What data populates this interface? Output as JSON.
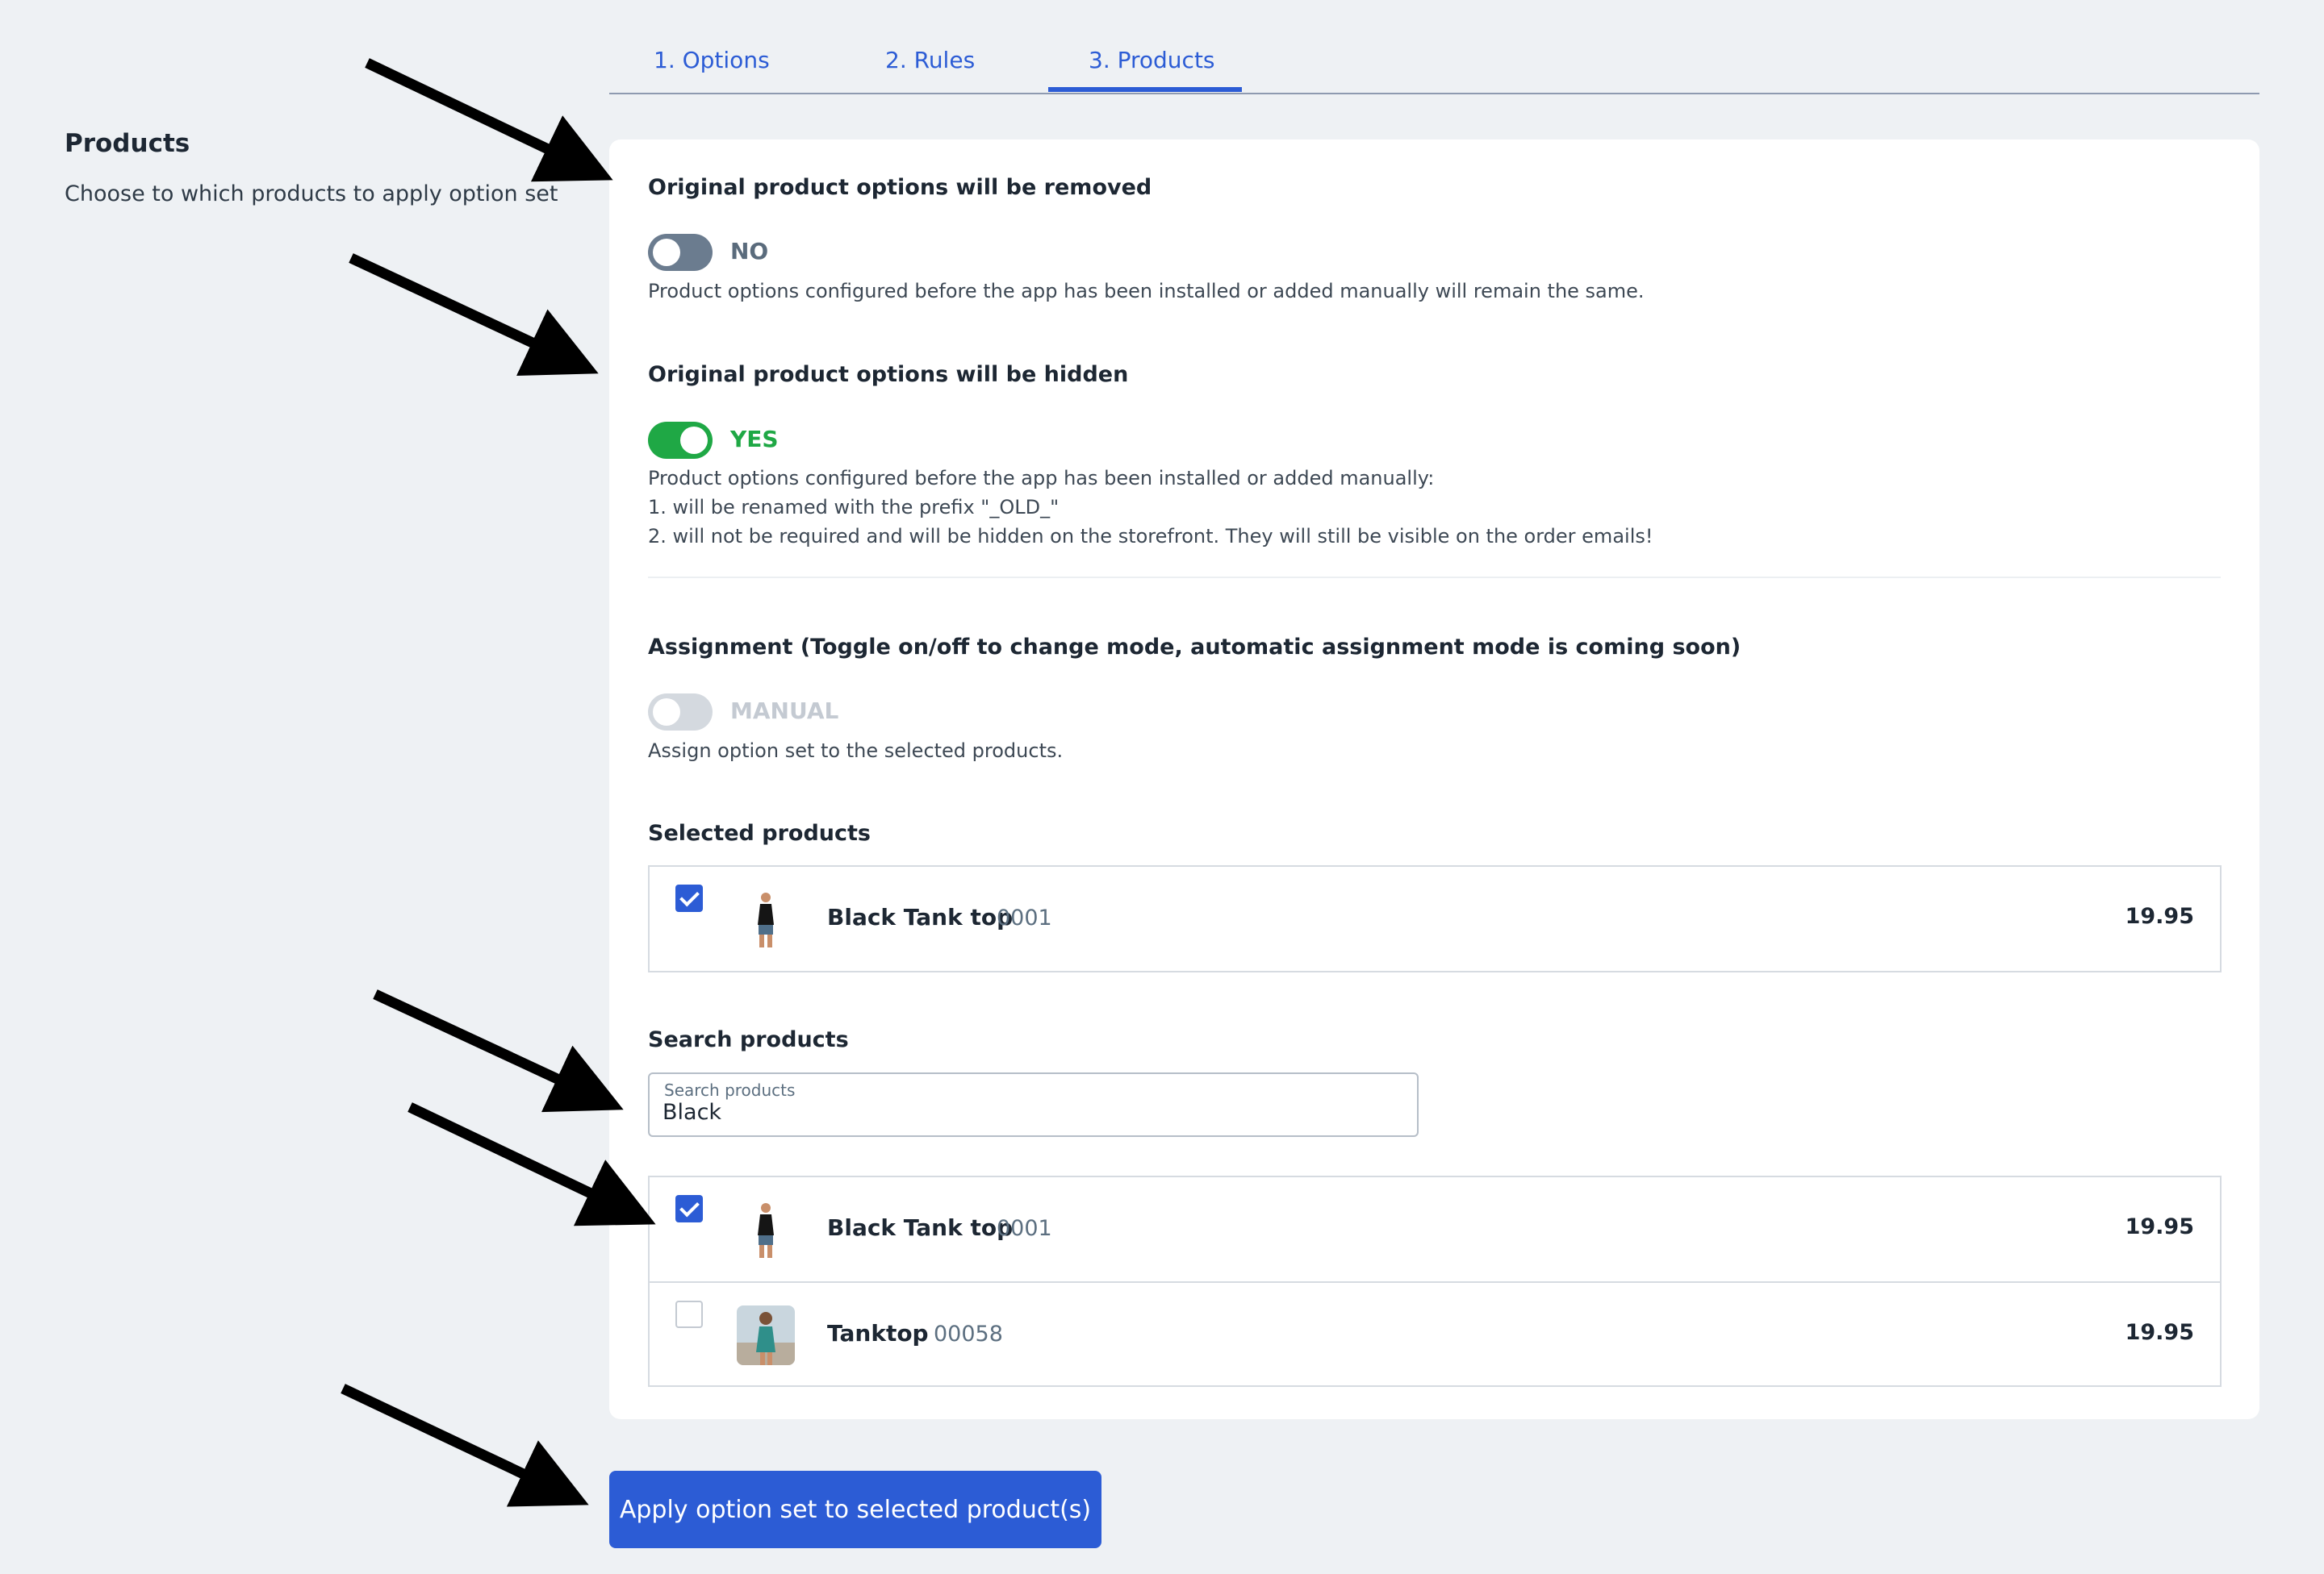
{
  "tabs": [
    {
      "label": "1. Options"
    },
    {
      "label": "2. Rules"
    },
    {
      "label": "3. Products",
      "active": true
    }
  ],
  "sidebar": {
    "title": "Products",
    "description": "Choose to which products to apply option set"
  },
  "remove_section": {
    "title": "Original product options will be removed",
    "toggle_state": "NO",
    "help": "Product options configured before the app has been installed or added manually will remain the same."
  },
  "hide_section": {
    "title": "Original product options will be hidden",
    "toggle_state": "YES",
    "help_lines": [
      "Product options configured before the app has been installed or added manually:",
      "1. will be renamed with the prefix \"_OLD_\"",
      "2. will not be required and will be hidden on the storefront. They will still be visible on the order emails!"
    ]
  },
  "assignment_section": {
    "title": "Assignment (Toggle on/off to change mode, automatic assignment mode is coming soon)",
    "toggle_state": "MANUAL",
    "help": "Assign option set to the selected products."
  },
  "selected_products": {
    "title": "Selected products",
    "items": [
      {
        "name": "Black Tank top",
        "sku": "0001",
        "price": "19.95",
        "checked": true
      }
    ]
  },
  "search_products": {
    "title": "Search products",
    "field_label": "Search products",
    "value": "Black",
    "results": [
      {
        "name": "Black Tank top",
        "sku": "0001",
        "price": "19.95",
        "checked": true
      },
      {
        "name": "Tanktop",
        "sku": "00058",
        "price": "19.95",
        "checked": false
      }
    ]
  },
  "apply_button": {
    "label": "Apply option set to selected product(s)"
  },
  "colors": {
    "primary": "#2c5cd5",
    "toggle_on": "#1fa845",
    "toggle_off": "#6b7c8f",
    "toggle_disabled": "#d4d9df",
    "background": "#eef1f4"
  },
  "icons": [
    "black-tank-top-thumbnail",
    "tanktop-thumbnail",
    "checkbox-checked-icon",
    "annotation-arrow"
  ]
}
